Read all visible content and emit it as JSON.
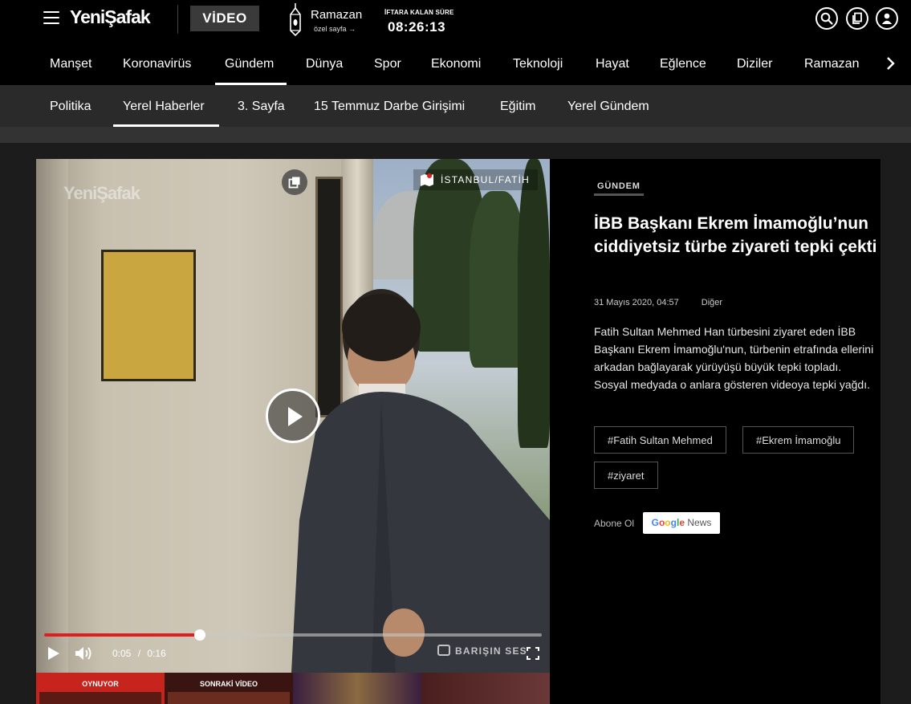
{
  "header": {
    "logo": "YeniŞafak",
    "video_button": "VİDEO",
    "ramazan_title": "Ramazan",
    "ramazan_link": "özel sayfa →",
    "iftar_label": "İFTARA KALAN SÜRE",
    "iftar_time": "08:26:13",
    "icons": [
      "search-icon",
      "bookmark-icon",
      "user-icon"
    ]
  },
  "nav_main": [
    "Manşet",
    "Koronavirüs",
    "Gündem",
    "Dünya",
    "Spor",
    "Ekonomi",
    "Teknoloji",
    "Hayat",
    "Eğlence",
    "Diziler",
    "Ramazan"
  ],
  "nav_main_active": "Gündem",
  "nav_sub": [
    "Politika",
    "Yerel Haberler",
    "3. Sayfa",
    "15 Temmuz Darbe Girişimi",
    "Eğitim",
    "Yerel Gündem"
  ],
  "nav_sub_active": "Yerel Haberler",
  "player": {
    "watermark": "YeniŞafak",
    "location": "İSTANBUL/FATİH",
    "current_time": "0:05",
    "separator": "/",
    "duration": "0:16",
    "progress_fraction": 0.3125,
    "barisin_label": "BARIŞIN SES",
    "accent_color": "#e01e1e"
  },
  "strip": {
    "now_playing": "OYNUYOR",
    "next_video": "SONRAKİ VİDEO"
  },
  "article": {
    "category": "GÜNDEM",
    "title": "İBB Başkanı Ekrem İmamoğlu’nun ciddiyetsiz türbe ziyareti tepki çekti",
    "date": "31 Mayıs 2020, 04:57",
    "source": "Diğer",
    "description": "Fatih Sultan Mehmed Han türbesini ziyaret eden İBB Başkanı Ekrem İmamoğlu'nun, türbenin etrafında ellerini arkadan bağlayarak yürüyüşü büyük tepki topladı. Sosyal medyada o anlara gösteren videoya tepki yağdı.",
    "tags": [
      "#Fatih Sultan Mehmed",
      "#Ekrem İmamoğlu",
      "#ziyaret"
    ],
    "subscribe_label": "Abone Ol",
    "google_news": {
      "google": "Google",
      "news": "News"
    }
  }
}
